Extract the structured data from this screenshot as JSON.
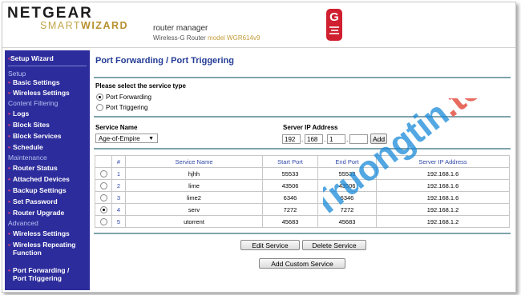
{
  "header": {
    "brand": "NETGEAR",
    "smart": "SMART",
    "wizard": "WIZARD",
    "title": "router manager",
    "subtitle_prefix": "Wireless-G Router",
    "subtitle_model": "model WGR614v9",
    "badge_letter": "G"
  },
  "sidebar": {
    "top_item": "Setup Wizard",
    "sections": {
      "setup": "Setup",
      "content": "Content Filtering",
      "maintenance": "Maintenance",
      "advanced": "Advanced"
    },
    "items": [
      "Basic Settings",
      "Wireless Settings",
      "Logs",
      "Block Sites",
      "Block Services",
      "Schedule",
      "Router Status",
      "Attached Devices",
      "Backup Settings",
      "Set Password",
      "Router Upgrade",
      "Wireless Settings",
      "Wireless Repeating Function",
      "Port Forwarding / Port Triggering"
    ]
  },
  "main": {
    "title": "Port Forwarding / Port Triggering",
    "service_type_label": "Please select the service type",
    "option_forwarding": "Port Forwarding",
    "option_triggering": "Port Triggering",
    "service_name_label": "Service Name",
    "service_name_value": "Age-of-Empire",
    "server_ip_label": "Server IP Address",
    "ip": [
      "192",
      "168",
      "1",
      ""
    ],
    "add_button": "Add",
    "edit_button": "Edit Service",
    "delete_button": "Delete Service",
    "add_custom_button": "Add Custom Service"
  },
  "table": {
    "headers": [
      "#",
      "Service Name",
      "Start Port",
      "End Port",
      "Server IP Address"
    ],
    "rows": [
      {
        "num": "1",
        "name": "hjhh",
        "start": "55533",
        "end": "55533",
        "ip": "192.168.1.6",
        "selected": false
      },
      {
        "num": "2",
        "name": "lime",
        "start": "43506",
        "end": "43506",
        "ip": "192.168.1.6",
        "selected": false
      },
      {
        "num": "3",
        "name": "lime2",
        "start": "6346",
        "end": "6346",
        "ip": "192.168.1.6",
        "selected": false
      },
      {
        "num": "4",
        "name": "serv",
        "start": "7272",
        "end": "7272",
        "ip": "192.168.1.2",
        "selected": true
      },
      {
        "num": "5",
        "name": "utorrent",
        "start": "45683",
        "end": "45683",
        "ip": "192.168.1.2",
        "selected": false
      }
    ]
  },
  "watermark": {
    "text": "Truongtin.top"
  },
  "colors": {
    "sidebar_bg": "#2d2c9c",
    "title_blue": "#243c96",
    "badge_red": "#d01f2f",
    "watermark_blue": "#1a8ad8",
    "watermark_red": "#e03a2a"
  }
}
